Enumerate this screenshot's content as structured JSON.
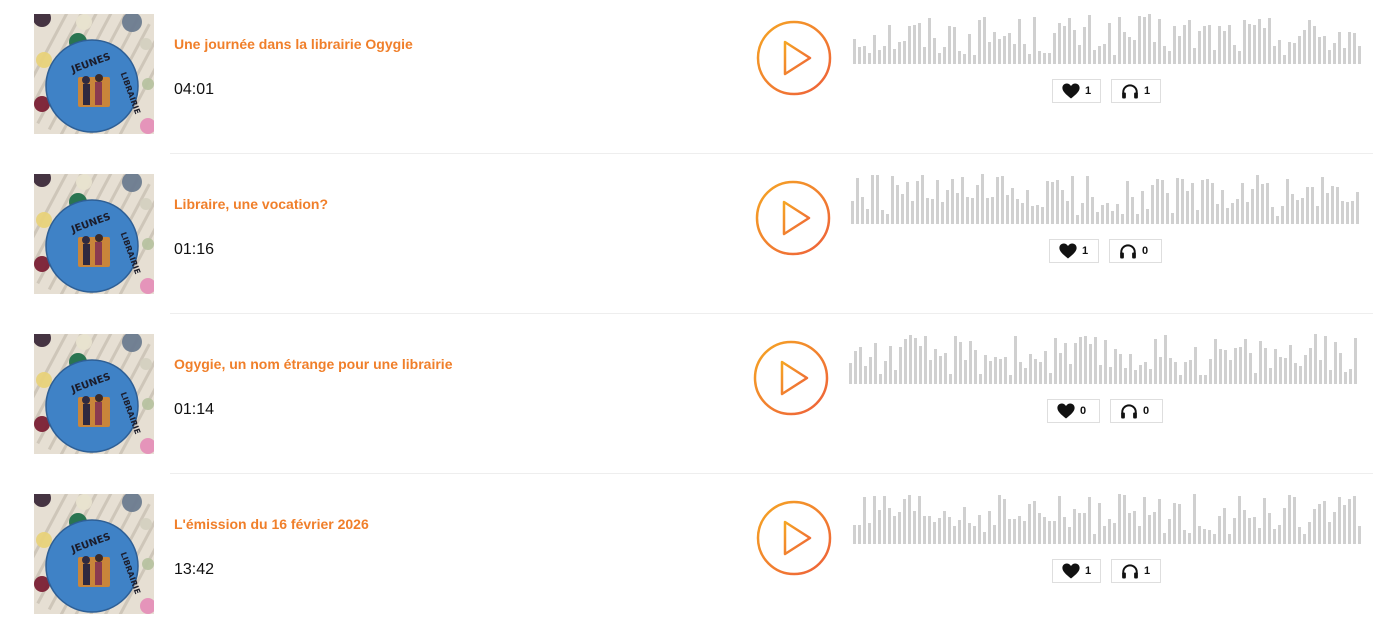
{
  "theme": {
    "title_color": "#f07f2a",
    "play_gradient_start": "#f5a623",
    "play_gradient_end": "#ee5f3a",
    "waveform_color": "#d0d0d0"
  },
  "episodes": [
    {
      "title": "Une journée dans la librairie Ogygie",
      "duration": "04:01",
      "likes": "1",
      "listens": "1",
      "thumbnail_icon": "jeunes-en-librairie-logo",
      "cover_text": "JEUNES EN LIBRAIRIE"
    },
    {
      "title": "Libraire, une vocation?",
      "duration": "01:16",
      "likes": "1",
      "listens": "0",
      "thumbnail_icon": "jeunes-en-librairie-logo",
      "cover_text": "JEUNES EN LIBRAIRIE"
    },
    {
      "title": "Ogygie, un nom étrange pour une librairie",
      "duration": "01:14",
      "likes": "0",
      "listens": "0",
      "thumbnail_icon": "jeunes-en-librairie-logo",
      "cover_text": "JEUNES EN LIBRAIRIE"
    },
    {
      "title": "L'émission du 16 février 2026",
      "duration": "13:42",
      "likes": "1",
      "listens": "1",
      "thumbnail_icon": "jeunes-en-librairie-logo",
      "cover_text": "JEUNES EN LIBRAIRIE"
    }
  ],
  "icons": {
    "play": "play-icon",
    "like": "heart-icon",
    "listens": "headphones-icon"
  }
}
